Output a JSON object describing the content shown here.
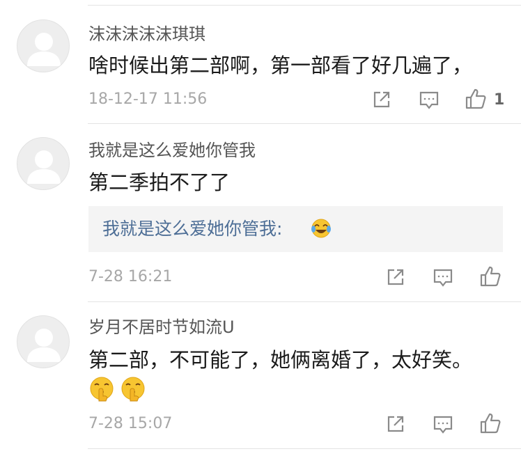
{
  "comments": [
    {
      "username": "沫沫沫沫沫琪琪",
      "content": "啥时候出第二部啊，第一部看了好几遍了，",
      "timestamp": "18-12-17 11:56",
      "like_count": "1"
    },
    {
      "username": "我就是这么爱她你管我",
      "content": "第二季拍不了了",
      "quote_text": "我就是这么爱她你管我:",
      "quote_emoji": "laughing-crying-emoji",
      "timestamp": "7-28 16:21"
    },
    {
      "username": "岁月不居时节如流U",
      "content": "第二部，不可能了，她俩离婚了，太好笑。",
      "emojis": [
        "shushing-face-emoji",
        "shushing-face-emoji"
      ],
      "timestamp": "7-28 15:07"
    }
  ],
  "icons": {
    "share": "share-icon",
    "reply": "comment-icon",
    "like": "thumbs-up-icon"
  },
  "colors": {
    "username": "#555555",
    "content": "#1a1a1a",
    "timestamp": "#a7a7a7",
    "quote_text": "#4d6e96",
    "quote_bg": "#f4f4f4",
    "divider": "#e3e3e3",
    "icon": "#8a8a8a"
  }
}
